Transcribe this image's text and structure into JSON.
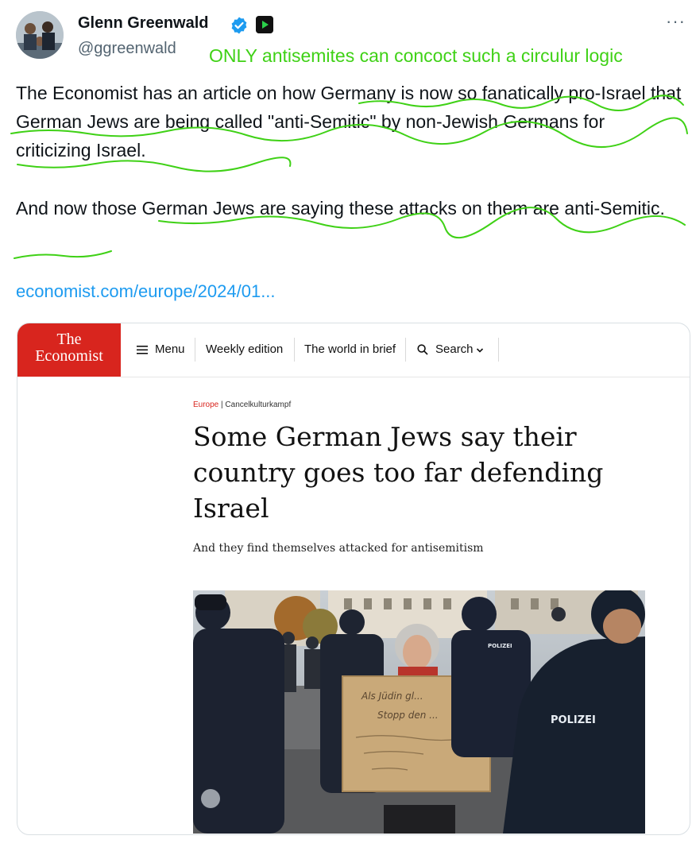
{
  "tweet": {
    "author_name": "Glenn Greenwald",
    "handle": "@ggreenwald",
    "more_label": "···",
    "annotation": "ONLY antisemites can concoct such a circulur logic",
    "paragraph1": "The Economist has an article on how Germany is now so fanatically pro-Israel that German Jews are being called \"anti-Semitic\" by non-Jewish Germans for criticizing Israel.",
    "paragraph2": "And now those German Jews are saying these attacks on them are anti-Semitic.",
    "link_text": "economist.com/europe/2024/01...",
    "colors": {
      "link": "#1d9bf0",
      "annotation": "#3fd116",
      "verified": "#1d9bf0"
    }
  },
  "card": {
    "logo_line1": "The",
    "logo_line2": "Economist",
    "nav": {
      "menu": "Menu",
      "weekly": "Weekly edition",
      "world": "The world in brief",
      "search": "Search"
    },
    "section_name": "Europe",
    "section_divider": " | ",
    "section_sub": "Cancelkulturkampf",
    "headline": "Some German Jews say their country goes too far defending Israel",
    "subheadline": "And they find themselves attacked for antisemitism",
    "photo": {
      "sign_line1": "Als Jüdin gl...",
      "sign_line2": "Stopp den ...",
      "police_label": "POLIZEI",
      "police_label_small": "POLIZEI"
    },
    "colors": {
      "brand": "#d8251e"
    }
  },
  "icons": [
    "verified-badge-icon",
    "media-badge-icon",
    "menu-hamburger-icon",
    "search-icon",
    "chevron-down-icon"
  ]
}
